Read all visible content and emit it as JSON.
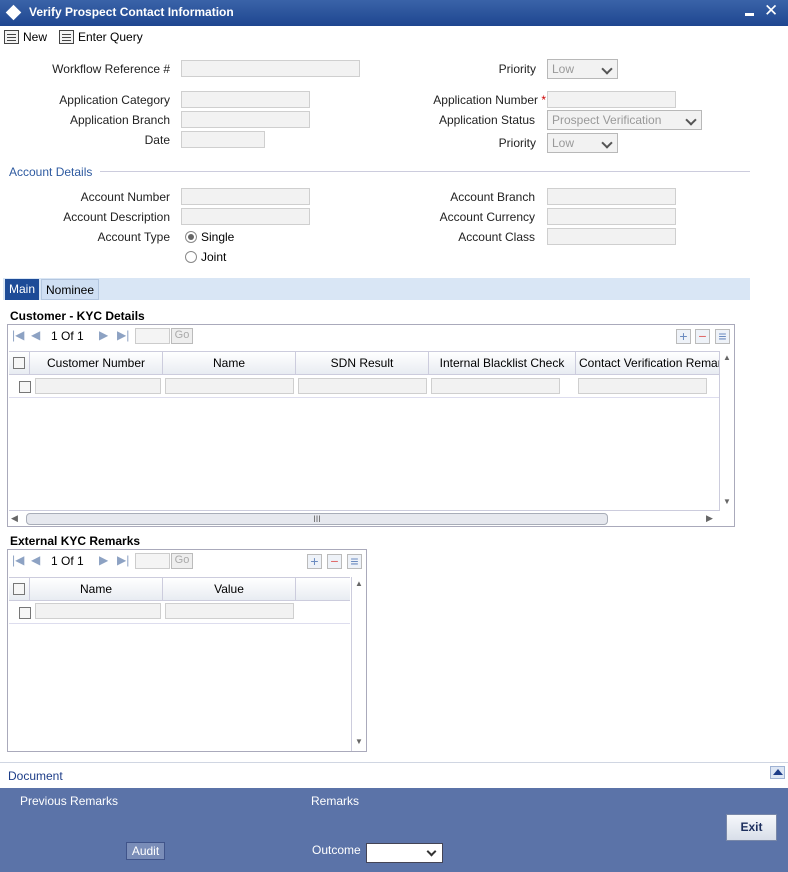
{
  "window": {
    "title": "Verify Prospect Contact Information"
  },
  "toolbar": {
    "new_label": "New",
    "enter_query_label": "Enter Query"
  },
  "header": {
    "workflow_ref_label": "Workflow Reference #",
    "priority_label": "Priority",
    "priority_value": "Low",
    "app_category_label": "Application Category",
    "app_branch_label": "Application Branch",
    "date_label": "Date",
    "app_number_label": "Application Number",
    "required_mark": "*",
    "app_status_label": "Application Status",
    "app_status_value": "Prospect Verification",
    "priority2_label": "Priority",
    "priority2_value": "Low"
  },
  "account": {
    "section_title": "Account Details",
    "number_label": "Account Number",
    "description_label": "Account Description",
    "type_label": "Account Type",
    "type_single": "Single",
    "type_joint": "Joint",
    "type_selected": "Single",
    "branch_label": "Account Branch",
    "currency_label": "Account Currency",
    "class_label": "Account Class"
  },
  "tabs": [
    {
      "label": "Main",
      "active": true
    },
    {
      "label": "Nominee",
      "active": false
    }
  ],
  "kyc_grid": {
    "title": "Customer - KYC Details",
    "page_current": "1",
    "page_of": "Of",
    "page_total": "1",
    "go_label": "Go",
    "columns": [
      "Customer Number",
      "Name",
      "SDN Result",
      "Internal Blacklist Check",
      "Contact Verification Remarks"
    ],
    "scroll_grip": "III"
  },
  "ext_grid": {
    "title": "External KYC Remarks",
    "page_current": "1",
    "page_of": "Of",
    "page_total": "1",
    "go_label": "Go",
    "columns": [
      "Name",
      "Value"
    ]
  },
  "bottom": {
    "document_label": "Document",
    "previous_remarks_label": "Previous Remarks",
    "remarks_label": "Remarks",
    "audit_label": "Audit",
    "outcome_label": "Outcome",
    "exit_label": "Exit"
  }
}
